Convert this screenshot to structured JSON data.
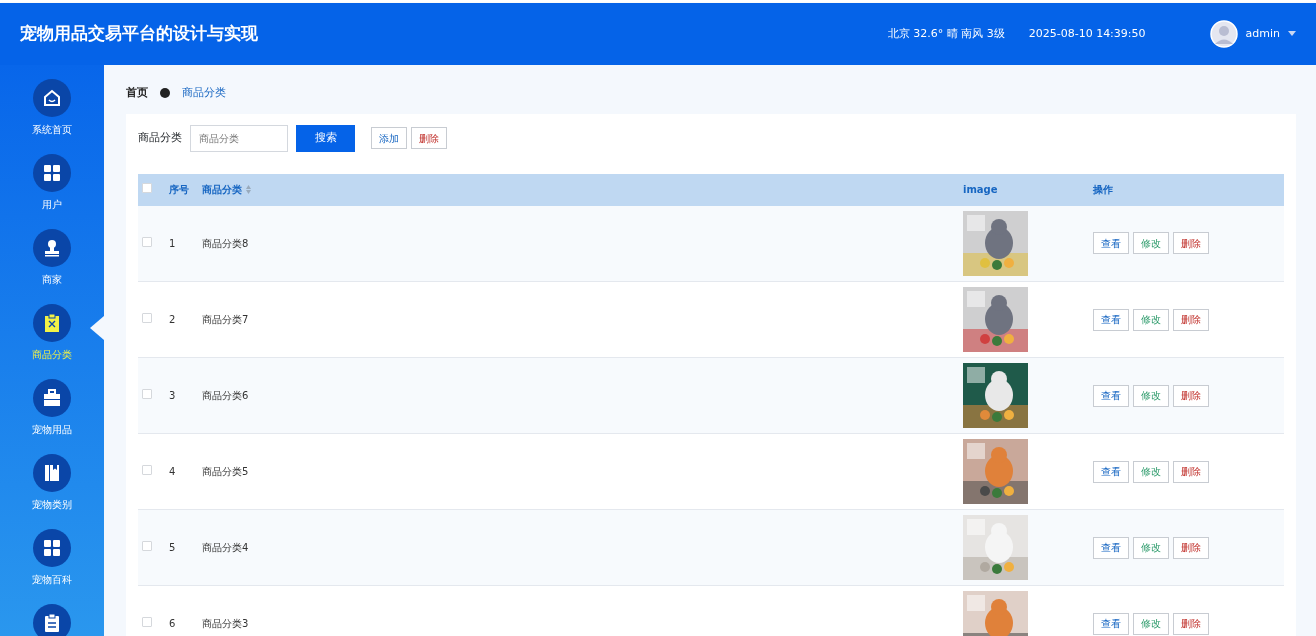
{
  "header": {
    "title": "宠物用品交易平台的设计与实现",
    "weather": "北京  32.6°  晴  南风  3级",
    "datetime": "2025-08-10 14:39:50",
    "user": "admin"
  },
  "sidebar": {
    "items": [
      {
        "label": "系统首页",
        "selected": false
      },
      {
        "label": "用户",
        "selected": false
      },
      {
        "label": "商家",
        "selected": false
      },
      {
        "label": "商品分类",
        "selected": true
      },
      {
        "label": "宠物用品",
        "selected": false
      },
      {
        "label": "宠物类别",
        "selected": false
      },
      {
        "label": "宠物百科",
        "selected": false
      },
      {
        "selected": false
      }
    ]
  },
  "breadcrumb": [
    "首页",
    "商品分类"
  ],
  "search": {
    "label": "商品分类",
    "placeholder": "商品分类",
    "button": "搜索",
    "add": "添加",
    "delete": "删除"
  },
  "table": {
    "select_all": {
      "checked": false
    },
    "columns": [
      "序号",
      "商品分类",
      "image",
      "操作"
    ],
    "rows": [
      {
        "checked": false,
        "index": "1",
        "name": "商品分类8",
        "image": {
          "kind": "picture"
        },
        "actions": [
          "查看",
          "修改",
          "删除"
        ]
      },
      {
        "checked": false,
        "index": "2",
        "name": "商品分类7",
        "image": {
          "kind": "picture"
        },
        "actions": [
          "查看",
          "修改",
          "删除"
        ]
      },
      {
        "checked": false,
        "index": "3",
        "name": "商品分类6",
        "image": {
          "kind": "picture"
        },
        "actions": [
          "查看",
          "修改",
          "删除"
        ]
      },
      {
        "checked": false,
        "index": "4",
        "name": "商品分类5",
        "image": {
          "kind": "picture"
        },
        "actions": [
          "查看",
          "修改",
          "删除"
        ]
      },
      {
        "checked": false,
        "index": "5",
        "name": "商品分类4",
        "image": {
          "kind": "picture"
        },
        "actions": [
          "查看",
          "修改",
          "删除"
        ]
      },
      {
        "checked": false,
        "index": "6",
        "name": "商品分类3",
        "image": {
          "kind": "picture"
        },
        "actions": [
          "查看",
          "修改",
          "删除"
        ]
      }
    ]
  }
}
